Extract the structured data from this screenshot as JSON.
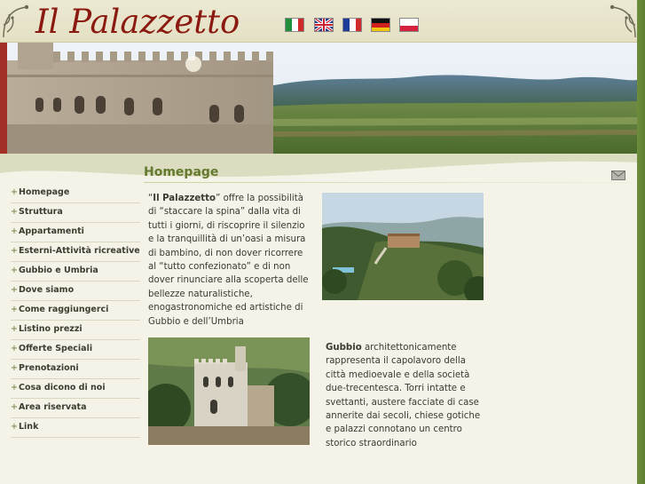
{
  "site": {
    "title": "Il Palazzetto",
    "languages": [
      {
        "code": "it",
        "name": "Italiano"
      },
      {
        "code": "en",
        "name": "English"
      },
      {
        "code": "fr",
        "name": "Français"
      },
      {
        "code": "de",
        "name": "Deutsch"
      },
      {
        "code": "pl",
        "name": "Polski"
      }
    ]
  },
  "menu": {
    "items": [
      "Homepage",
      "Struttura",
      "Appartamenti",
      "Esterni-Attività ricreative",
      "Gubbio e Umbria",
      "Dove siamo",
      "Come raggiungerci",
      "Listino prezzi",
      "Offerte Speciali",
      "Prenotazioni",
      "Cosa dicono di noi",
      "Area riservata",
      "Link"
    ]
  },
  "main": {
    "page_title": "Homepage",
    "para1": {
      "quote_open": "“",
      "name": "Il Palazzetto",
      "text": "” offre la possibilità di “staccare la spina” dalla vita di tutti i giorni, di riscoprire il silenzio e la tranquillità di un’oasi a misura di bambino, di non dover ricorrere al “tutto confezionato” e di non dover rinunciare alla scoperta delle bellezze naturalistiche, enogastronomiche ed artistiche di Gubbio e dell’Umbria"
    },
    "para2": {
      "name": "Gubbio",
      "text": " architettonicamente rappresenta il capolavoro della città medioevale e della società due-trecentesca. Torri intatte e svettanti, austere facciate di case annerite dai secoli, chiese gotiche e palazzi connotano un centro storico straordinario"
    }
  },
  "colors": {
    "title": "#8a1a10",
    "accent_green": "#647a2e",
    "background": "#f3f1e6"
  }
}
